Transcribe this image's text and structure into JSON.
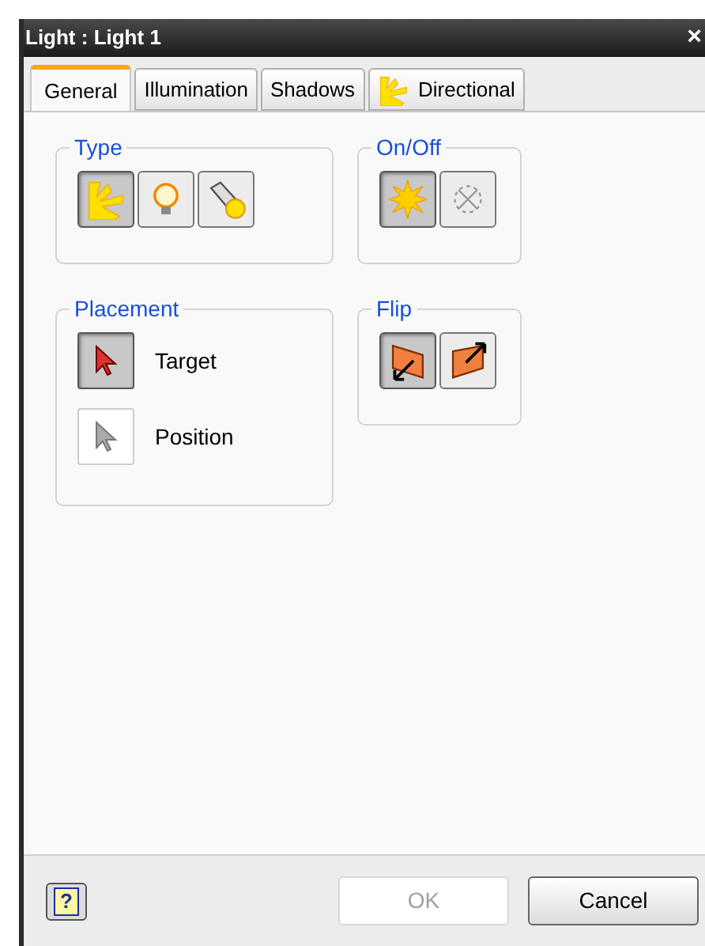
{
  "window": {
    "title": "Light : Light 1",
    "close": "×"
  },
  "tabs": [
    {
      "label": "General",
      "selected": true,
      "kind": "plain"
    },
    {
      "label": "Illumination",
      "selected": false,
      "kind": "plain"
    },
    {
      "label": "Shadows",
      "selected": false,
      "kind": "plain"
    },
    {
      "label": "Directional",
      "selected": false,
      "kind": "sun-rays"
    }
  ],
  "groups": [
    {
      "title": "Type",
      "kind": "icons",
      "buttons": [
        {
          "kind": "sun-rays",
          "selected": true
        },
        {
          "kind": "bulb",
          "selected": false
        },
        {
          "kind": "spot",
          "selected": false
        }
      ]
    },
    {
      "title": "On/Off",
      "kind": "icons",
      "buttons": [
        {
          "kind": "sun",
          "selected": true
        },
        {
          "kind": "off",
          "selected": false
        }
      ]
    },
    {
      "title": "Placement",
      "kind": "options",
      "options": [
        {
          "label": "Target",
          "selected": true
        },
        {
          "label": "Position",
          "selected": false
        }
      ]
    },
    {
      "title": "Flip",
      "kind": "icons",
      "buttons": [
        {
          "kind": "flip-down",
          "selected": true
        },
        {
          "kind": "flip-up",
          "selected": false
        }
      ]
    }
  ],
  "footer": {
    "help": "?",
    "buttons": [
      {
        "label": "OK",
        "disabled": true
      },
      {
        "label": "Cancel",
        "disabled": false
      }
    ]
  }
}
